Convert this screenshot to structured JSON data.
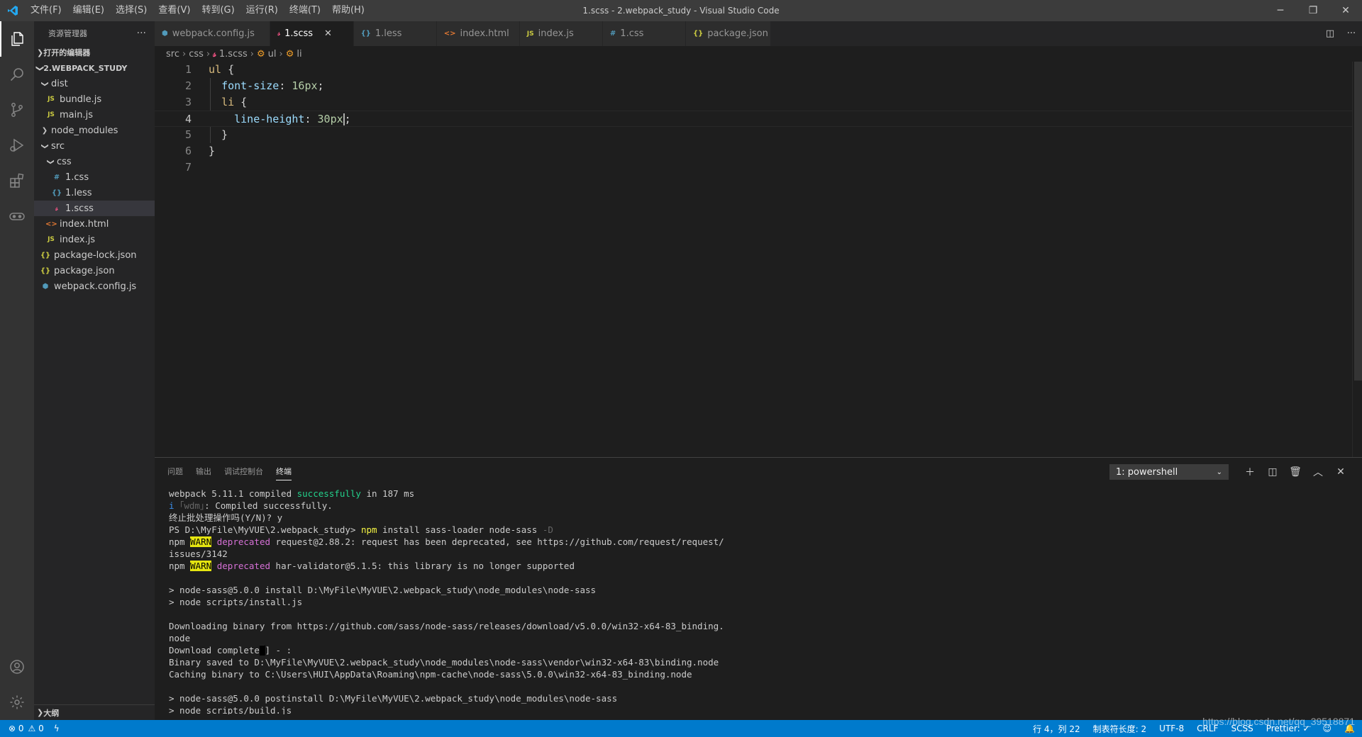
{
  "window": {
    "title": "1.scss - 2.webpack_study - Visual Studio Code",
    "menu": [
      "文件(F)",
      "编辑(E)",
      "选择(S)",
      "查看(V)",
      "转到(G)",
      "运行(R)",
      "终端(T)",
      "帮助(H)"
    ],
    "controls": {
      "minimize": "─",
      "restore": "❐",
      "close": "✕"
    }
  },
  "activity_bar": {
    "items": [
      "files-icon",
      "search-icon",
      "source-control-icon",
      "run-debug-icon",
      "extensions-icon",
      "remote-icon"
    ],
    "bottom": [
      "account-icon",
      "settings-icon"
    ]
  },
  "sidebar": {
    "title": "资源管理器",
    "more": "···",
    "open_editors": "打开的编辑器",
    "project": "2.WEBPACK_STUDY",
    "tree": [
      {
        "label": "dist",
        "type": "folder",
        "open": true,
        "depth": 1
      },
      {
        "label": "bundle.js",
        "type": "js",
        "depth": 2
      },
      {
        "label": "main.js",
        "type": "js",
        "depth": 2
      },
      {
        "label": "node_modules",
        "type": "folder",
        "open": false,
        "depth": 1
      },
      {
        "label": "src",
        "type": "folder",
        "open": true,
        "depth": 1
      },
      {
        "label": "css",
        "type": "folder",
        "open": true,
        "depth": 2
      },
      {
        "label": "1.css",
        "type": "css",
        "depth": 3
      },
      {
        "label": "1.less",
        "type": "less",
        "depth": 3
      },
      {
        "label": "1.scss",
        "type": "scss",
        "depth": 3,
        "selected": true
      },
      {
        "label": "index.html",
        "type": "html",
        "depth": 2
      },
      {
        "label": "index.js",
        "type": "js",
        "depth": 2
      },
      {
        "label": "package-lock.json",
        "type": "json",
        "depth": 1
      },
      {
        "label": "package.json",
        "type": "json",
        "depth": 1
      },
      {
        "label": "webpack.config.js",
        "type": "webpack",
        "depth": 1
      }
    ],
    "outline": "大纲"
  },
  "tabs": [
    {
      "label": "webpack.config.js",
      "type": "webpack"
    },
    {
      "label": "1.scss",
      "type": "scss",
      "active": true
    },
    {
      "label": "1.less",
      "type": "less"
    },
    {
      "label": "index.html",
      "type": "html"
    },
    {
      "label": "index.js",
      "type": "js"
    },
    {
      "label": "1.css",
      "type": "css"
    },
    {
      "label": "package.json",
      "type": "json"
    }
  ],
  "icons": {
    "js": "JS",
    "css": "#",
    "less": "{}",
    "scss": "𝓈",
    "html": "<>",
    "json": "{}",
    "webpack": "⬢"
  },
  "breadcrumb": {
    "parts": [
      "src",
      "css",
      "1.scss",
      "ul",
      "li"
    ]
  },
  "editor": {
    "active_line": 4,
    "lines": [
      {
        "n": "1",
        "text": "ul {"
      },
      {
        "n": "2",
        "text": "  font-size: 16px;"
      },
      {
        "n": "3",
        "text": "  li {"
      },
      {
        "n": "4",
        "text": "    line-height: 30px;"
      },
      {
        "n": "5",
        "text": "  }"
      },
      {
        "n": "6",
        "text": "}"
      },
      {
        "n": "7",
        "text": ""
      }
    ]
  },
  "panel": {
    "tabs": [
      "问题",
      "输出",
      "调试控制台",
      "终端"
    ],
    "active_tab": "终端",
    "terminal_select": "1: powershell",
    "actions": [
      "plus-icon",
      "split-icon",
      "trash-icon",
      "maximize-icon",
      "close-icon"
    ],
    "terminal_lines": [
      "webpack 5.11.1 compiled successfully in 187 ms",
      "i ｢wdm｣: Compiled successfully.",
      "终止批处理操作吗(Y/N)? y",
      "PS D:\\MyFile\\MyVUE\\2.webpack_study> npm install sass-loader node-sass -D",
      "npm WARN deprecated request@2.88.2: request has been deprecated, see https://github.com/request/request/",
      "issues/3142",
      "npm WARN deprecated har-validator@5.1.5: this library is no longer supported",
      "",
      "> node-sass@5.0.0 install D:\\MyFile\\MyVUE\\2.webpack_study\\node_modules\\node-sass",
      "> node scripts/install.js",
      "",
      "Downloading binary from https://github.com/sass/node-sass/releases/download/v5.0.0/win32-x64-83_binding.",
      "node",
      "Download complete ] - :",
      "Binary saved to D:\\MyFile\\MyVUE\\2.webpack_study\\node_modules\\node-sass\\vendor\\win32-x64-83\\binding.node",
      "Caching binary to C:\\Users\\HUI\\AppData\\Roaming\\npm-cache\\node-sass\\5.0.0\\win32-x64-83_binding.node",
      "",
      "> node-sass@5.0.0 postinstall D:\\MyFile\\MyVUE\\2.webpack_study\\node_modules\\node-sass",
      "> node scripts/build.js"
    ]
  },
  "statusbar": {
    "errors": "⊗ 0",
    "warnings": "⚠ 0",
    "lightning": "ϟ",
    "position": "行 4，列 22",
    "tab_size": "制表符长度: 2",
    "encoding": "UTF-8",
    "eol": "CRLF",
    "language": "SCSS",
    "prettier": "Prettier: ✓",
    "watermark": "https://blog.csdn.net/qq_39518871"
  },
  "colors": {
    "status_bar": "#007acc",
    "editor_bg": "#1e1e1e",
    "selector": "#d7ba7d",
    "property": "#9cdcfe",
    "number": "#b5cea8"
  }
}
